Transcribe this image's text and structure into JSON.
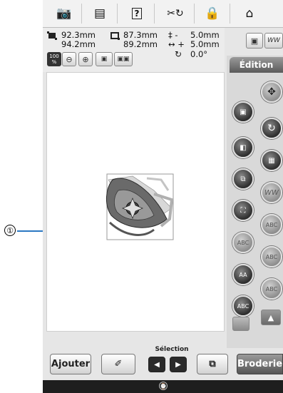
{
  "callout": {
    "number": "①"
  },
  "toolbar": {
    "icons": [
      "camera-icon",
      "document-icon",
      "help-icon",
      "needle-thread-icon",
      "lock-icon",
      "home-icon"
    ],
    "help_label": "?"
  },
  "info": {
    "width_top": "92.3mm",
    "height_top": "94.2mm",
    "width_second": "87.3mm",
    "height_second": "89.2mm",
    "vert_label": "‡  -",
    "vert_value": "5.0mm",
    "horiz_label": "↔  +",
    "horiz_value": "5.0mm",
    "rotation_value": "0.0°",
    "zoom_label_top": "100",
    "zoom_label_bottom": "%"
  },
  "right_panel": {
    "tab_label": "Édition"
  },
  "bottom": {
    "selection_label": "Sélection",
    "add_label": "Ajouter",
    "embroidery_label": "Broderie"
  },
  "colors": {
    "accent_blue": "#2b78c2",
    "tab_gray": "#6e6e6e",
    "status_bar": "#1e1e1e"
  }
}
